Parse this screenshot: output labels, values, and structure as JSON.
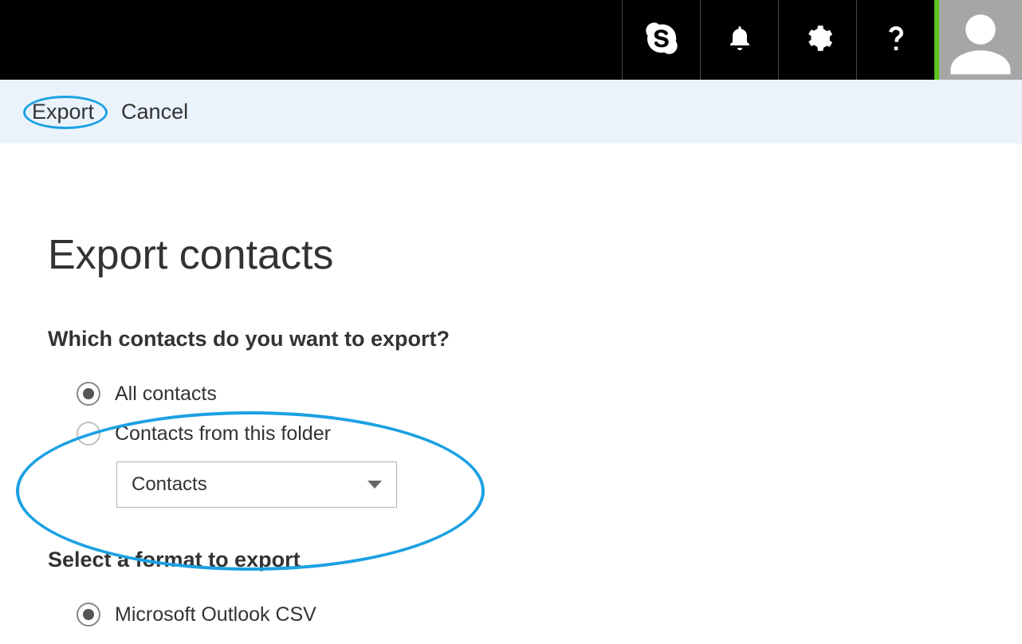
{
  "actionbar": {
    "export_label": "Export",
    "cancel_label": "Cancel"
  },
  "page": {
    "title": "Export contacts"
  },
  "section1": {
    "heading": "Which contacts do you want to export?",
    "option_all": "All contacts",
    "option_folder": "Contacts from this folder",
    "folder_selected": "Contacts"
  },
  "section2": {
    "heading": "Select a format to export",
    "option_csv": "Microsoft Outlook CSV"
  }
}
